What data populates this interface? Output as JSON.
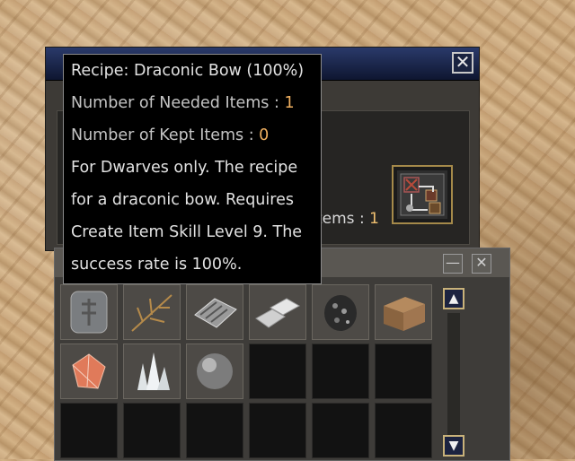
{
  "tooltip": {
    "title": "Recipe: Draconic Bow (100%)",
    "needed_label": "Number of Needed Items : ",
    "needed_value": "1",
    "kept_label": "Number of Kept Items : ",
    "kept_value": "0",
    "description_lines": [
      "For Dwarves only. The recipe",
      "for a draconic bow. Requires",
      "Create Item Skill Level 9. The",
      "success rate is 100%."
    ]
  },
  "recipe_window": {
    "close_glyph": "✕",
    "partial_label": "tems : ",
    "partial_value": "1",
    "product_icon": "draconic-bow-recipe-icon"
  },
  "inventory": {
    "minimize_glyph": "—",
    "close_glyph": "✕",
    "scroll_up_glyph": "▲",
    "scroll_down_glyph": "▼",
    "items": [
      {
        "icon": "stone-tablet-icon"
      },
      {
        "icon": "branch-icon"
      },
      {
        "icon": "metal-plate-icon"
      },
      {
        "icon": "ingot-icon"
      },
      {
        "icon": "ore-icon"
      },
      {
        "icon": "wood-block-icon"
      },
      {
        "icon": "crystal-gem-icon"
      },
      {
        "icon": "quartz-cluster-icon"
      },
      {
        "icon": "sphere-icon"
      }
    ],
    "empty_slot_count": 9
  },
  "colors": {
    "value_accent": "#f0b060",
    "title_bar": "#0e1630",
    "slot_border_accent": "#c9b27a"
  }
}
